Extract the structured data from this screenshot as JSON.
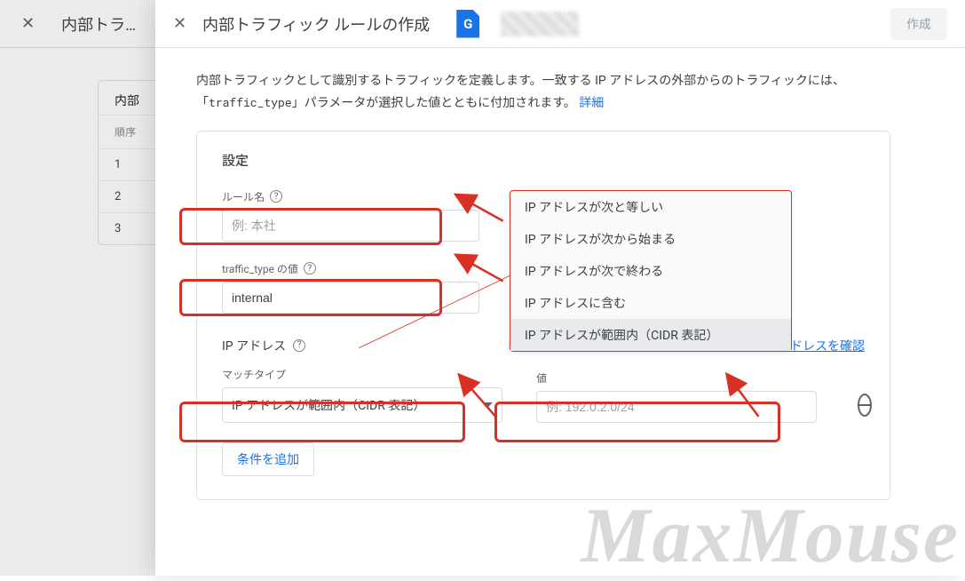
{
  "bg": {
    "close_glyph": "✕",
    "title": "内部トラ…",
    "table": {
      "header_title": "内部",
      "order_label": "順序",
      "rows": [
        "1",
        "2",
        "3"
      ]
    }
  },
  "panel": {
    "close_glyph": "✕",
    "title": "内部トラフィック ルールの作成",
    "g_letter": "G",
    "create_label": "作成",
    "intro_pre": "内部トラフィックとして識別するトラフィックを定義します。一致する IP アドレスの外部からのトラフィックには、「",
    "intro_code": "traffic_type",
    "intro_post": "」パラメータが選択した値とともに付加されます。",
    "intro_link": "詳細"
  },
  "card": {
    "title": "設定",
    "rule_name_label": "ルール名",
    "rule_name_placeholder": "例: 本社",
    "rule_name_value": "",
    "traffic_type_label": "traffic_type の値",
    "traffic_type_value": "internal",
    "ip_section_label": "IP アドレス",
    "check_ip_label": "IP アドレスを確認",
    "match_type_label": "マッチタイプ",
    "match_type_selected": "IP アドレスが範囲内（CIDR 表記）",
    "value_label": "値",
    "value_placeholder": "例: 192.0.2.0/24",
    "value_value": "",
    "add_condition_label": "条件を追加",
    "help_glyph": "?"
  },
  "listbox": {
    "options": [
      "IP アドレスが次と等しい",
      "IP アドレスが次から始まる",
      "IP アドレスが次で終わる",
      "IP アドレスに含む",
      "IP アドレスが範囲内（CIDR 表記）"
    ],
    "selected_index": 4
  },
  "watermark": "MaxMouse",
  "chart_data": null
}
